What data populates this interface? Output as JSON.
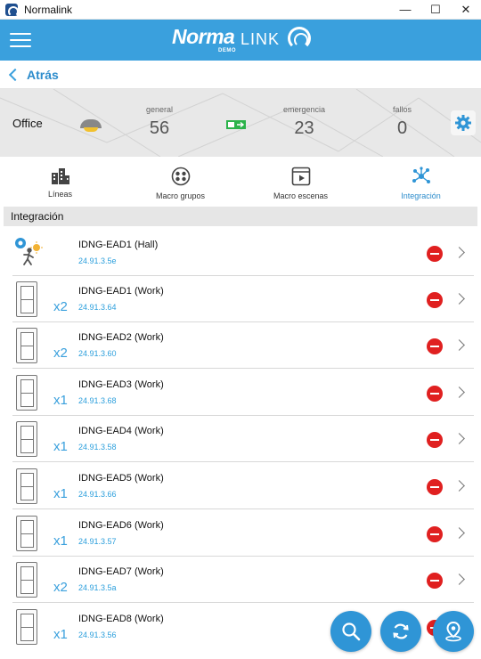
{
  "window": {
    "title": "Normalink",
    "minimize": "—",
    "maximize": "☐",
    "close": "✕"
  },
  "brand": {
    "main": "Norma",
    "sub": "LINK",
    "tag": "DEMO"
  },
  "nav": {
    "back_label": "Atrás"
  },
  "stats": {
    "location": "Office",
    "general": {
      "label": "general",
      "value": "56"
    },
    "emergencia": {
      "label": "emergencia",
      "value": "23"
    },
    "fallos": {
      "label": "fallos",
      "value": "0"
    }
  },
  "tabs": [
    {
      "label": "Líneas",
      "icon": "building-icon",
      "active": false
    },
    {
      "label": "Macro grupos",
      "icon": "group-icon",
      "active": false
    },
    {
      "label": "Macro escenas",
      "icon": "scene-icon",
      "active": false
    },
    {
      "label": "Integración",
      "icon": "network-icon",
      "active": true
    }
  ],
  "section": {
    "title": "Integración"
  },
  "items": [
    {
      "name": "IDNG-EAD1 (Hall)",
      "address": "24.91.3.5e",
      "multiplier": "",
      "icon": "sensor-icon"
    },
    {
      "name": "IDNG-EAD1 (Work)",
      "address": "24.91.3.64",
      "multiplier": "x2",
      "icon": "switch-panel-icon"
    },
    {
      "name": "IDNG-EAD2 (Work)",
      "address": "24.91.3.60",
      "multiplier": "x2",
      "icon": "switch-panel-icon"
    },
    {
      "name": "IDNG-EAD3 (Work)",
      "address": "24.91.3.68",
      "multiplier": "x1",
      "icon": "switch-panel-icon"
    },
    {
      "name": "IDNG-EAD4 (Work)",
      "address": "24.91.3.58",
      "multiplier": "x1",
      "icon": "switch-panel-icon"
    },
    {
      "name": "IDNG-EAD5 (Work)",
      "address": "24.91.3.66",
      "multiplier": "x1",
      "icon": "switch-panel-icon"
    },
    {
      "name": "IDNG-EAD6 (Work)",
      "address": "24.91.3.57",
      "multiplier": "x1",
      "icon": "switch-panel-icon"
    },
    {
      "name": "IDNG-EAD7 (Work)",
      "address": "24.91.3.5a",
      "multiplier": "x2",
      "icon": "switch-panel-icon"
    },
    {
      "name": "IDNG-EAD8 (Work)",
      "address": "24.91.3.56",
      "multiplier": "x1",
      "icon": "switch-panel-icon"
    }
  ],
  "colors": {
    "accent": "#3aa0dd",
    "danger": "#e02020",
    "panel": "#e8e8e8"
  }
}
